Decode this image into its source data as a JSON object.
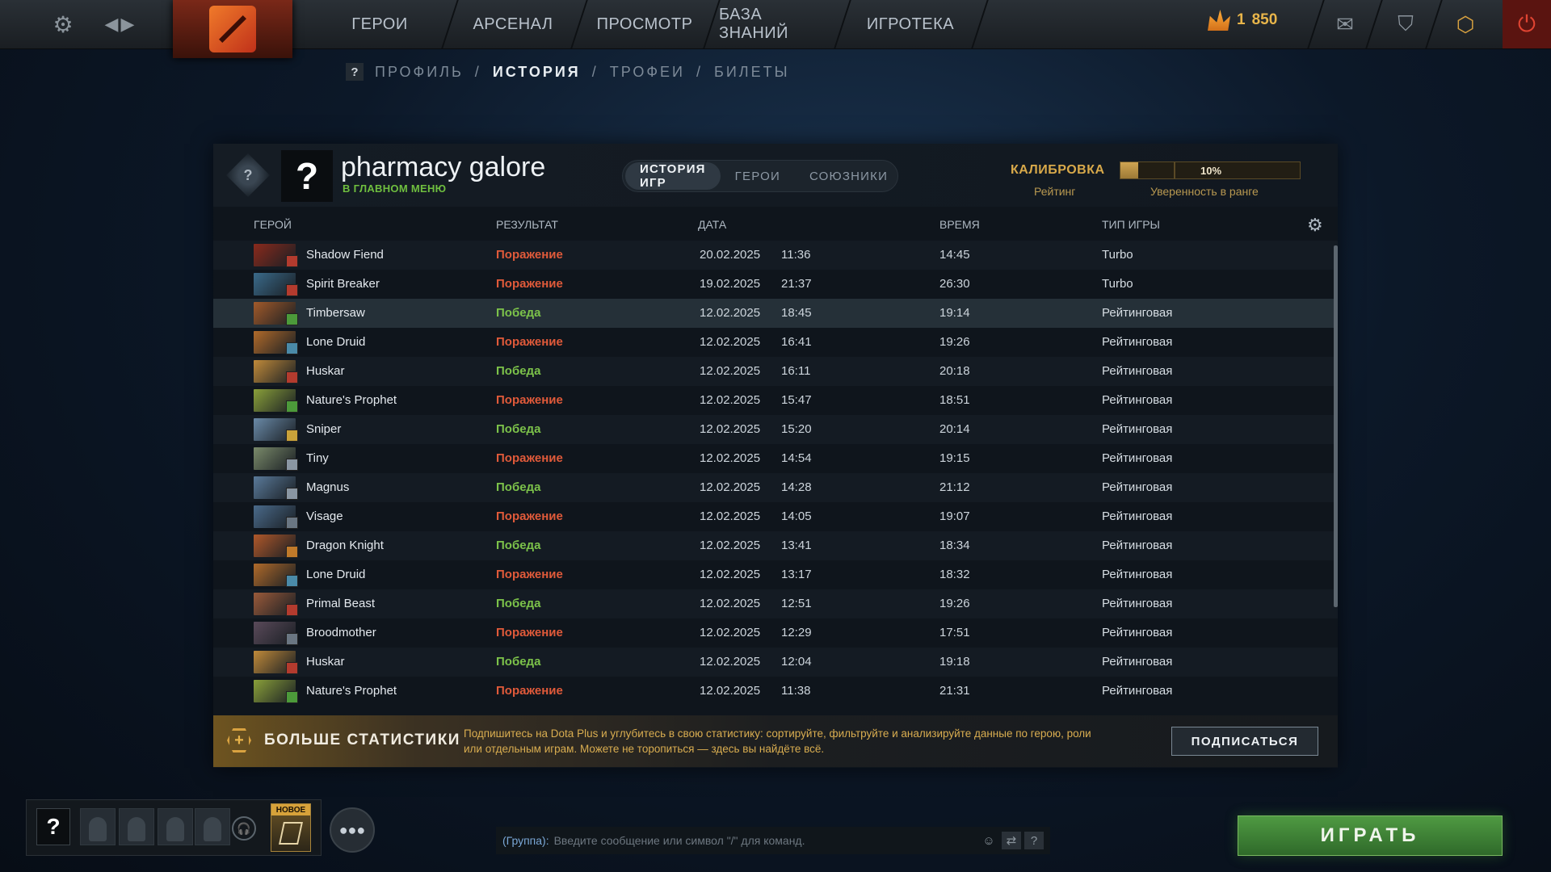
{
  "topbar": {
    "nav": [
      "ГЕРОИ",
      "АРСЕНАЛ",
      "ПРОСМОТР",
      "БАЗА ЗНАНИЙ",
      "ИГРОТЕКА"
    ],
    "currency_count": "1",
    "currency_value": "850"
  },
  "breadcrumb": {
    "help": "?",
    "items": [
      "ПРОФИЛЬ",
      "/",
      "ИСТОРИЯ",
      "/",
      "ТРОФЕИ",
      "/",
      "БИЛЕТЫ"
    ]
  },
  "profile": {
    "rank_symbol": "?",
    "avatar_symbol": "?",
    "name": "pharmacy galore",
    "status": "В ГЛАВНОМ МЕНЮ",
    "tabs": [
      "ИСТОРИЯ ИГР",
      "ГЕРОИ",
      "СОЮЗНИКИ"
    ],
    "calibration_title": "КАЛИБРОВКА",
    "rating_label": "Рейтинг",
    "confidence_percent": 10,
    "confidence_text": "10%",
    "confidence_label": "Уверенность в ранге"
  },
  "table": {
    "columns": [
      "ГЕРОЙ",
      "РЕЗУЛЬТАТ",
      "ДАТА",
      "ВРЕМЯ",
      "ТИП ИГРЫ"
    ],
    "rows": [
      {
        "hero": "Shadow Fiend",
        "result": "Поражение",
        "win": false,
        "date": "20.02.2025",
        "time": "11:36",
        "duration": "14:45",
        "mode": "Turbo",
        "color": "#8a2a1c",
        "role_color": "#b33b2e"
      },
      {
        "hero": "Spirit Breaker",
        "result": "Поражение",
        "win": false,
        "date": "19.02.2025",
        "time": "21:37",
        "duration": "26:30",
        "mode": "Turbo",
        "color": "#3a6a8a",
        "role_color": "#b33b2e"
      },
      {
        "hero": "Timbersaw",
        "result": "Победа",
        "win": true,
        "date": "12.02.2025",
        "time": "18:45",
        "duration": "19:14",
        "mode": "Рейтинговая",
        "color": "#a25a2a",
        "role_color": "#4c9a3a"
      },
      {
        "hero": "Lone Druid",
        "result": "Поражение",
        "win": false,
        "date": "12.02.2025",
        "time": "16:41",
        "duration": "19:26",
        "mode": "Рейтинговая",
        "color": "#b06a2a",
        "role_color": "#4a8aa8"
      },
      {
        "hero": "Huskar",
        "result": "Победа",
        "win": true,
        "date": "12.02.2025",
        "time": "16:11",
        "duration": "20:18",
        "mode": "Рейтинговая",
        "color": "#c08a3a",
        "role_color": "#b33b2e"
      },
      {
        "hero": "Nature's Prophet",
        "result": "Поражение",
        "win": false,
        "date": "12.02.2025",
        "time": "15:47",
        "duration": "18:51",
        "mode": "Рейтинговая",
        "color": "#8aa03a",
        "role_color": "#4c9a3a"
      },
      {
        "hero": "Sniper",
        "result": "Победа",
        "win": true,
        "date": "12.02.2025",
        "time": "15:20",
        "duration": "20:14",
        "mode": "Рейтинговая",
        "color": "#6a8aa8",
        "role_color": "#c9a23a"
      },
      {
        "hero": "Tiny",
        "result": "Поражение",
        "win": false,
        "date": "12.02.2025",
        "time": "14:54",
        "duration": "19:15",
        "mode": "Рейтинговая",
        "color": "#7a8a6a",
        "role_color": "#8a96a2"
      },
      {
        "hero": "Magnus",
        "result": "Победа",
        "win": true,
        "date": "12.02.2025",
        "time": "14:28",
        "duration": "21:12",
        "mode": "Рейтинговая",
        "color": "#5a7a9a",
        "role_color": "#8a96a2"
      },
      {
        "hero": "Visage",
        "result": "Поражение",
        "win": false,
        "date": "12.02.2025",
        "time": "14:05",
        "duration": "19:07",
        "mode": "Рейтинговая",
        "color": "#4a6a8a",
        "role_color": "#6a7682"
      },
      {
        "hero": "Dragon Knight",
        "result": "Победа",
        "win": true,
        "date": "12.02.2025",
        "time": "13:41",
        "duration": "18:34",
        "mode": "Рейтинговая",
        "color": "#b0582a",
        "role_color": "#c07a2a"
      },
      {
        "hero": "Lone Druid",
        "result": "Поражение",
        "win": false,
        "date": "12.02.2025",
        "time": "13:17",
        "duration": "18:32",
        "mode": "Рейтинговая",
        "color": "#b06a2a",
        "role_color": "#4a8aa8"
      },
      {
        "hero": "Primal Beast",
        "result": "Победа",
        "win": true,
        "date": "12.02.2025",
        "time": "12:51",
        "duration": "19:26",
        "mode": "Рейтинговая",
        "color": "#9a5a3a",
        "role_color": "#b33b2e"
      },
      {
        "hero": "Broodmother",
        "result": "Поражение",
        "win": false,
        "date": "12.02.2025",
        "time": "12:29",
        "duration": "17:51",
        "mode": "Рейтинговая",
        "color": "#5a4a5a",
        "role_color": "#6a7682"
      },
      {
        "hero": "Huskar",
        "result": "Победа",
        "win": true,
        "date": "12.02.2025",
        "time": "12:04",
        "duration": "19:18",
        "mode": "Рейтинговая",
        "color": "#c08a3a",
        "role_color": "#b33b2e"
      },
      {
        "hero": "Nature's Prophet",
        "result": "Поражение",
        "win": false,
        "date": "12.02.2025",
        "time": "11:38",
        "duration": "21:31",
        "mode": "Рейтинговая",
        "color": "#8aa03a",
        "role_color": "#4c9a3a"
      }
    ]
  },
  "promo": {
    "title": "БОЛЬШЕ СТАТИСТИКИ",
    "text": "Подпишитесь на Dota Plus и углубитесь в свою статистику: сортируйте, фильтруйте и анализируйте данные по герою, роли или отдельным играм. Можете не торопиться — здесь вы найдёте всё.",
    "button": "ПОДПИСАТЬСЯ"
  },
  "party": {
    "help": "?",
    "new_badge": "НОВОЕ"
  },
  "chat": {
    "label": "(Группа):",
    "placeholder": "Введите сообщение или символ \"/\" для команд.",
    "help": "?"
  },
  "play_button": "ИГРАТЬ",
  "colors": {
    "win": "#7cc24a",
    "loss": "#e05a3a",
    "gold": "#d8a94a",
    "play": "#3f8a38"
  }
}
